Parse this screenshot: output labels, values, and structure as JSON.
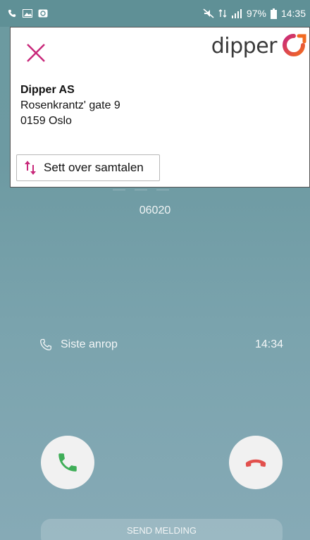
{
  "status_bar": {
    "battery": "97%",
    "time": "14:35"
  },
  "overlay": {
    "brand": "dipper",
    "company_name": "Dipper AS",
    "address_line1": "Rosenkrantz' gate 9",
    "address_line2": "0159 Oslo",
    "transfer_label": "Sett over samtalen"
  },
  "call": {
    "number": "06020",
    "recent_label": "Siste anrop",
    "recent_time": "14:34",
    "send_message_label": "SEND MELDING"
  },
  "colors": {
    "accent_pink": "#c8287a",
    "answer_green": "#3fae58",
    "decline_red": "#e2504d"
  }
}
